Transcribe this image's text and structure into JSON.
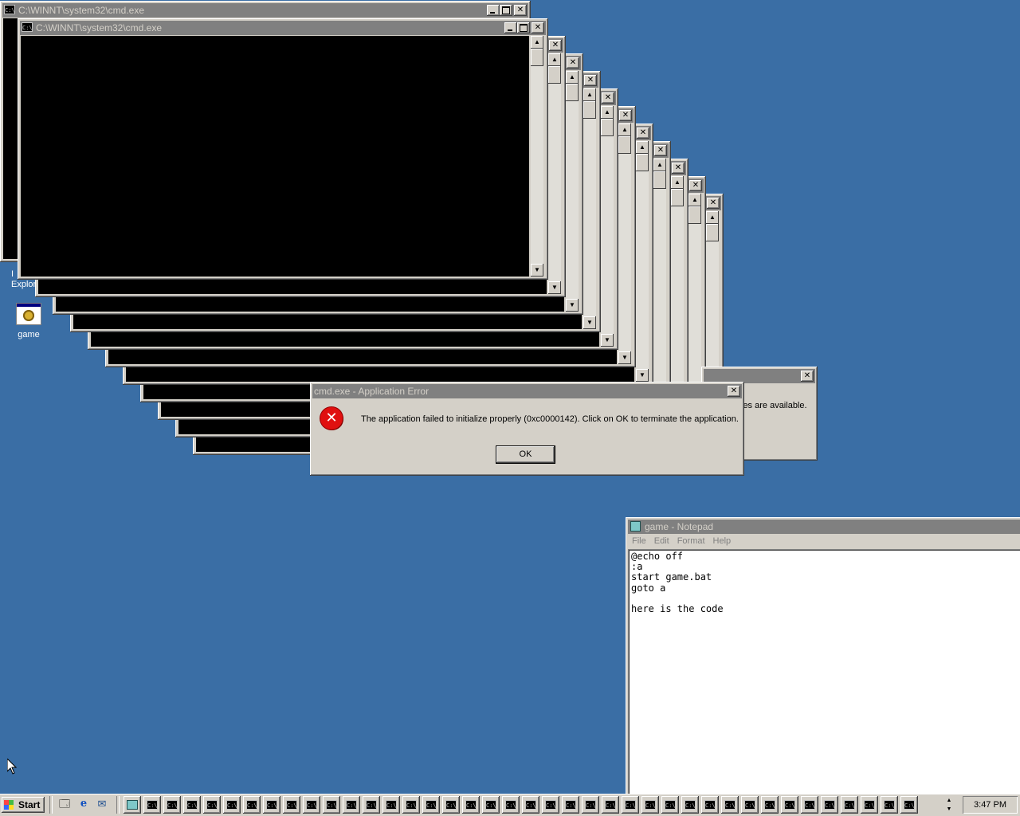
{
  "cmd_window": {
    "title": "C:\\WINNT\\system32\\cmd.exe",
    "icon": "cmd-icon",
    "glyph": "C:\\"
  },
  "desktop_icons": [
    {
      "label_partial": "I\nExplor",
      "icon": "internet-explorer-icon"
    },
    {
      "label": "game",
      "icon": "batch-file-icon"
    }
  ],
  "error_dialog": {
    "title": "cmd.exe - Application Error",
    "message": "The application failed to initialize properly (0xc0000142). Click on OK to terminate the application.",
    "ok_label": "OK",
    "icon": "error-x-icon"
  },
  "back_dialog": {
    "text_fragment": "ies are available."
  },
  "notepad": {
    "title": "game - Notepad",
    "menu": [
      "File",
      "Edit",
      "Format",
      "Help"
    ],
    "content": "@echo off\n:a\nstart game.bat\ngoto a\n\nhere is the code"
  },
  "taskbar": {
    "start_label": "Start",
    "quick_launch": [
      "show-desktop-icon",
      "internet-explorer-icon",
      "outlook-express-icon"
    ],
    "task_count": 40,
    "clock": "3:47 PM"
  },
  "colors": {
    "desktop": "#3a6ea5",
    "inactive_title": "#808080",
    "face": "#d4d0c8"
  }
}
